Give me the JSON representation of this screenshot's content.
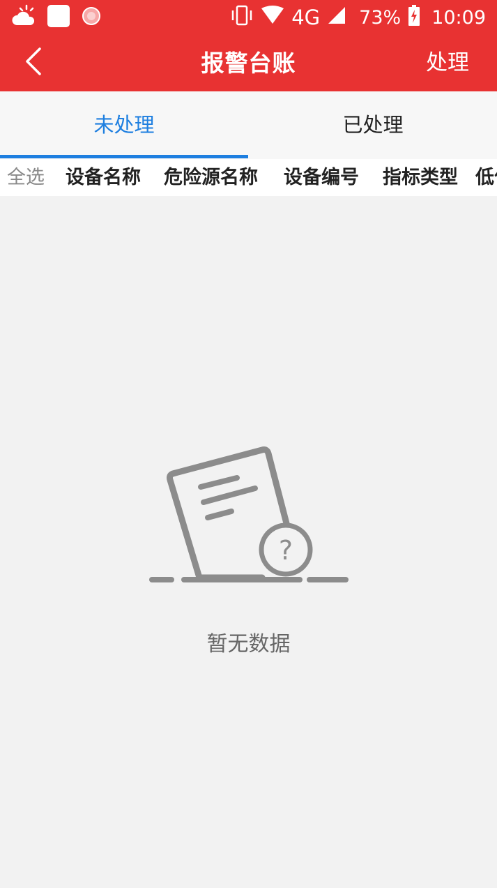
{
  "status_bar": {
    "icons_left": [
      "weather-icon",
      "square-notification-icon",
      "circle-notification-icon"
    ],
    "network": "4G",
    "battery": "73%",
    "time": "10:09"
  },
  "title_bar": {
    "title": "报警台账",
    "action": "处理"
  },
  "tabs": [
    {
      "label": "未处理",
      "active": true
    },
    {
      "label": "已处理",
      "active": false
    }
  ],
  "table": {
    "select_all": "全选",
    "columns": [
      "设备名称",
      "危险源名称",
      "设备编号",
      "指标类型",
      "低位"
    ]
  },
  "empty_state": {
    "message": "暂无数据"
  },
  "colors": {
    "brand_red": "#e83232",
    "tab_active": "#1e7fe0",
    "background": "#f2f2f2"
  }
}
